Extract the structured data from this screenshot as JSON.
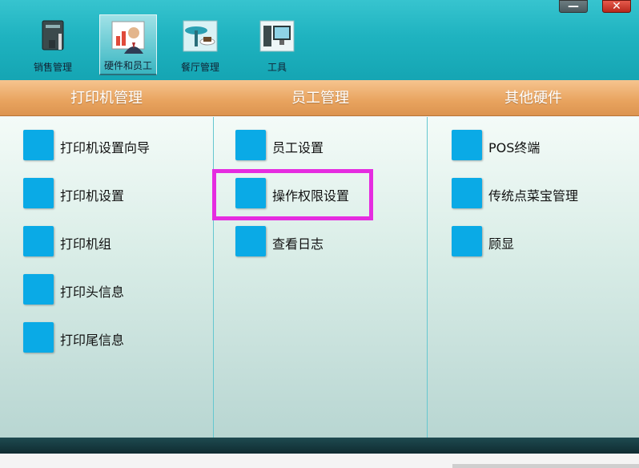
{
  "toolbar": {
    "tabs": [
      {
        "label": "销售管理",
        "icon": "ledger-book-icon"
      },
      {
        "label": "硬件和员工",
        "icon": "staff-chart-icon",
        "active": true
      },
      {
        "label": "餐厅管理",
        "icon": "restaurant-table-icon"
      },
      {
        "label": "工具",
        "icon": "computer-tools-icon"
      }
    ]
  },
  "window": {
    "minimize_label": "—",
    "close_label": "✕"
  },
  "columns": [
    {
      "title": "打印机管理",
      "items": [
        "打印机设置向导",
        "打印机设置",
        "打印机组",
        "打印头信息",
        "打印尾信息"
      ]
    },
    {
      "title": "员工管理",
      "items": [
        "员工设置",
        "操作权限设置",
        "查看日志"
      ]
    },
    {
      "title": "其他硬件",
      "items": [
        "POS终端",
        "传统点菜宝管理",
        "顾显"
      ]
    }
  ],
  "colors": {
    "toolbar": "#1fb3c0",
    "header": "#e8a35e",
    "item_square": "#0aaae6",
    "highlight": "#e52ce0"
  }
}
